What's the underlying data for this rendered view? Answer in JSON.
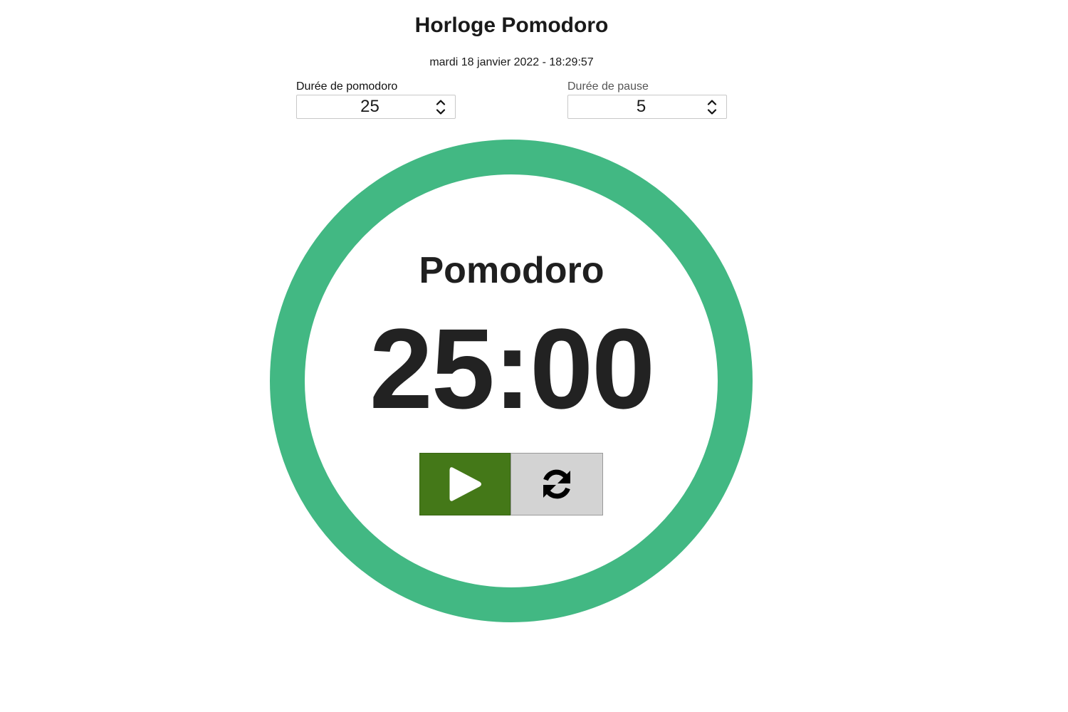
{
  "title": "Horloge Pomodoro",
  "datetime": "mardi 18 janvier 2022 - 18:29:57",
  "settings": {
    "pomodoro": {
      "label": "Durée de pomodoro",
      "value": "25"
    },
    "pause": {
      "label": "Durée de pause",
      "value": "5"
    }
  },
  "timer": {
    "mode": "Pomodoro",
    "display": "25:00",
    "progress_fraction": 1.0
  },
  "controls": {
    "play_icon": "play-icon",
    "reset_icon": "refresh-icon"
  },
  "colors": {
    "ring": "#42b883",
    "play_button": "#447818",
    "reset_button": "#d3d3d3"
  }
}
